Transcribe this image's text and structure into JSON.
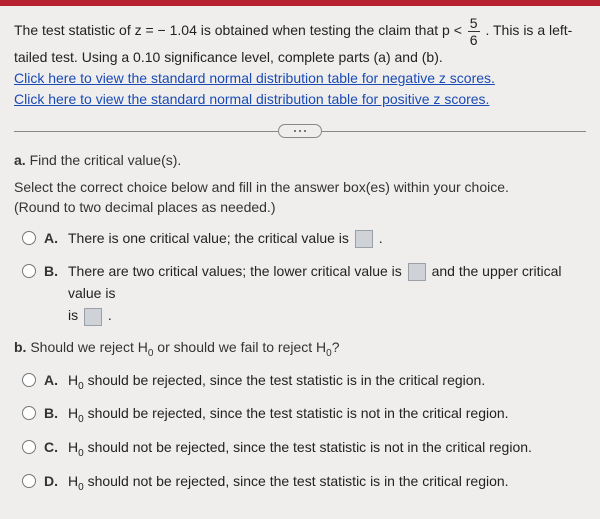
{
  "intro": {
    "t1": "The test statistic of z = − 1.04 is obtained when testing the claim that p < ",
    "frac_num": "5",
    "frac_den": "6",
    "t2": ". This is a left-tailed test. Using a 0.10 significance level, complete parts (a) and (b).",
    "link1": "Click here to view the standard normal distribution table for negative z scores.",
    "link2": "Click here to view the standard normal distribution table for positive z scores."
  },
  "partA": {
    "heading_prefix": "a.",
    "heading_text": " Find the critical value(s).",
    "instr1": "Select the correct choice below and fill in the answer box(es) within your choice.",
    "instr2": "(Round to two decimal places as needed.)",
    "A": {
      "letter": "A.",
      "t1": "There is one critical value; the critical value is ",
      "t2": "."
    },
    "B": {
      "letter": "B.",
      "t1": "There are two critical values; the lower critical value is ",
      "t2": " and the upper critical value is ",
      "t3": "."
    }
  },
  "partB": {
    "heading_prefix": "b.",
    "heading_text_1": " Should we reject H",
    "heading_sub1": "0",
    "heading_text_2": " or should we fail to reject H",
    "heading_sub2": "0",
    "heading_text_3": "?",
    "A": {
      "letter": "A.",
      "t1": "H",
      "sub": "0",
      "t2": " should be rejected, since the test statistic is in the critical region."
    },
    "B": {
      "letter": "B.",
      "t1": "H",
      "sub": "0",
      "t2": " should be rejected, since the test statistic is not in the critical region."
    },
    "C": {
      "letter": "C.",
      "t1": "H",
      "sub": "0",
      "t2": " should not be rejected, since the test statistic is not in the critical region."
    },
    "D": {
      "letter": "D.",
      "t1": "H",
      "sub": "0",
      "t2": " should not be rejected, since the test statistic is in the critical region."
    }
  }
}
